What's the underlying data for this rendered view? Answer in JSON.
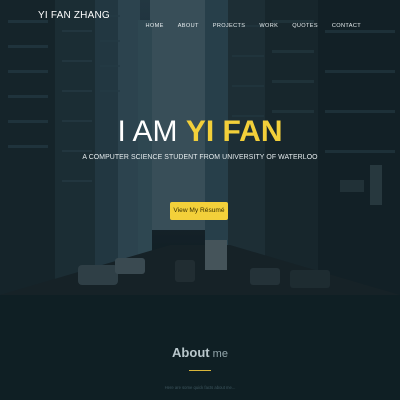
{
  "brand": "YI FAN ZHANG",
  "nav": [
    "HOME",
    "ABOUT",
    "PROJECTS",
    "WORK",
    "QUOTES",
    "CONTACT"
  ],
  "hero": {
    "headline_prefix": "I AM ",
    "headline_name": "YI FAN",
    "tagline": "A COMPUTER SCIENCE STUDENT FROM UNIVERSITY OF WATERLOO",
    "resume_button": "View My Résumé"
  },
  "about": {
    "title_strong": "About",
    "title_light": " me",
    "subtitle": "Here are some quick facts about me..."
  },
  "colors": {
    "accent": "#f3d03a",
    "hero_overlay": "#1e3038",
    "section_bg": "#0f1f24"
  }
}
